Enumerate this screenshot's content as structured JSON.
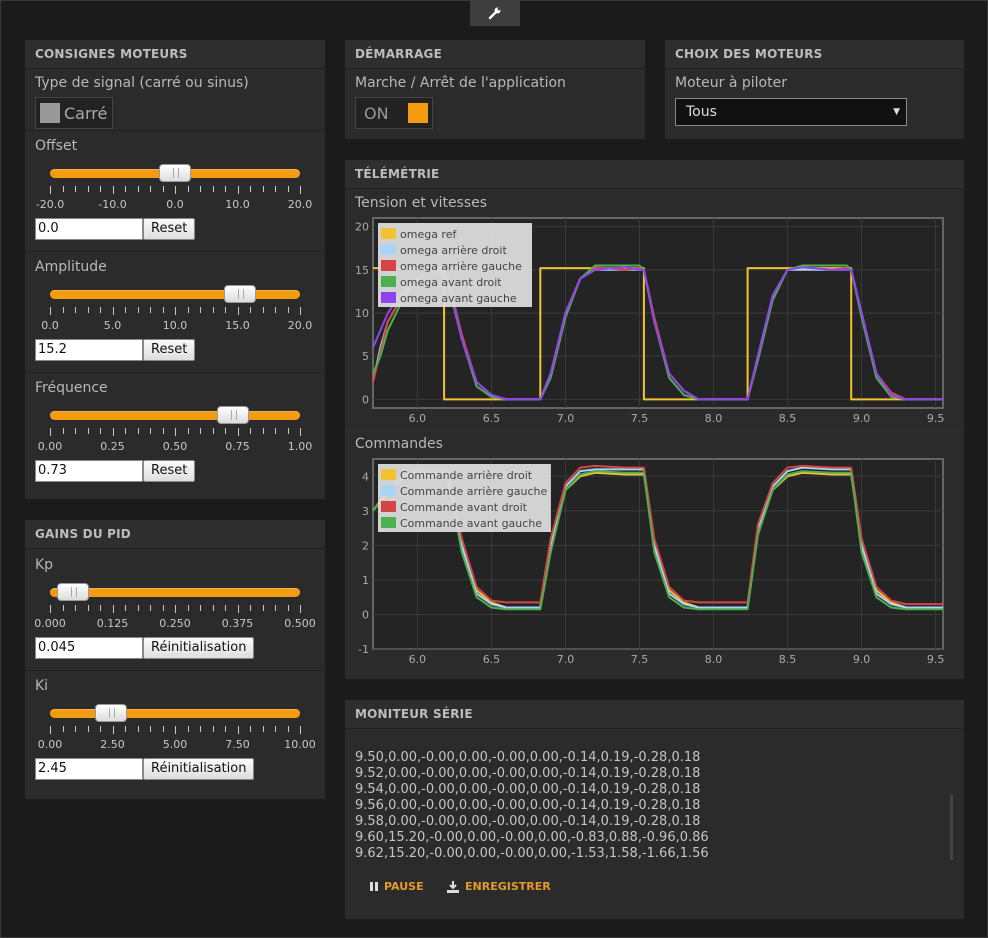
{
  "toolbar": {
    "settings_icon": "wrench-icon"
  },
  "consignes": {
    "title": "CONSIGNES MOTEURS",
    "signal_label": "Type de signal (carré ou sinus)",
    "signal_value": "Carré",
    "sliders": [
      {
        "label": "Offset",
        "value": "0.0",
        "reset": "Reset",
        "min": -20,
        "max": 20,
        "current": 0,
        "ticks": [
          "-20.0",
          "-10.0",
          "0.0",
          "10.0",
          "20.0"
        ]
      },
      {
        "label": "Amplitude",
        "value": "15.2",
        "reset": "Reset",
        "min": 0,
        "max": 20,
        "current": 15.2,
        "ticks": [
          "0.0",
          "5.0",
          "10.0",
          "15.0",
          "20.0"
        ]
      },
      {
        "label": "Fréquence",
        "value": "0.73",
        "reset": "Reset",
        "min": 0,
        "max": 1,
        "current": 0.73,
        "ticks": [
          "0.00",
          "0.25",
          "0.50",
          "0.75",
          "1.00"
        ]
      }
    ]
  },
  "pid": {
    "title": "GAINS DU PID",
    "sliders": [
      {
        "label": "Kp",
        "value": "0.045",
        "reset": "Réinitialisation",
        "min": 0,
        "max": 0.5,
        "current": 0.045,
        "ticks": [
          "0.000",
          "0.125",
          "0.250",
          "0.375",
          "0.500"
        ]
      },
      {
        "label": "Ki",
        "value": "2.45",
        "reset": "Réinitialisation",
        "min": 0,
        "max": 10,
        "current": 2.45,
        "ticks": [
          "0.00",
          "2.50",
          "5.00",
          "7.50",
          "10.00"
        ]
      }
    ]
  },
  "demarrage": {
    "title": "DÉMARRAGE",
    "label": "Marche / Arrêt de l'application",
    "toggle": "ON",
    "toggle_color": "#f39c12"
  },
  "choix": {
    "title": "CHOIX DES MOTEURS",
    "label": "Moteur à piloter",
    "selected": "Tous"
  },
  "telemetrie": {
    "title": "TÉLÉMÉTRIE",
    "chart1_title": "Tension et vitesses",
    "chart2_title": "Commandes"
  },
  "chart_data": [
    {
      "type": "line",
      "title": "Tension et vitesses",
      "xlim": [
        5.7,
        9.55
      ],
      "ylim": [
        -1,
        21
      ],
      "xticks": [
        "6.0",
        "6.5",
        "7.0",
        "7.5",
        "8.0",
        "8.5",
        "9.0",
        "9.5"
      ],
      "yticks": [
        "0",
        "5",
        "10",
        "15",
        "20"
      ],
      "legend_position": "top-left",
      "series": [
        {
          "name": "omega ref",
          "color": "#f1c232",
          "step": true,
          "x": [
            5.7,
            6.18,
            6.18,
            6.83,
            6.83,
            7.53,
            7.53,
            8.23,
            8.23,
            8.93,
            8.93,
            9.55
          ],
          "y": [
            15.2,
            15.2,
            0,
            0,
            15.2,
            15.2,
            0,
            0,
            15.2,
            15.2,
            0,
            0
          ]
        },
        {
          "name": "omega arrière droit",
          "color": "#a8d4f5",
          "x": [
            5.7,
            5.75,
            5.8,
            5.9,
            6.0,
            6.1,
            6.2,
            6.3,
            6.4,
            6.5,
            6.6,
            6.8,
            6.83,
            6.9,
            7.0,
            7.1,
            7.2,
            7.4,
            7.5,
            7.53,
            7.6,
            7.7,
            7.8,
            7.9,
            8.2,
            8.23,
            8.3,
            8.4,
            8.5,
            8.6,
            8.8,
            8.9,
            8.93,
            9.0,
            9.1,
            9.2,
            9.3,
            9.55
          ],
          "y": [
            2,
            6,
            9,
            12,
            14,
            15,
            14,
            7,
            2,
            0.5,
            0,
            0,
            0,
            3,
            10,
            14,
            15,
            15,
            15,
            15,
            9,
            3,
            1,
            0,
            0,
            0,
            5,
            12,
            15,
            15,
            15,
            15,
            15,
            10,
            3,
            0.5,
            0,
            0
          ]
        },
        {
          "name": "omega arrière gauche",
          "color": "#d64545",
          "x": [
            5.7,
            5.75,
            5.8,
            5.9,
            6.0,
            6.1,
            6.2,
            6.3,
            6.4,
            6.5,
            6.6,
            6.8,
            6.83,
            6.9,
            7.0,
            7.1,
            7.2,
            7.4,
            7.5,
            7.53,
            7.6,
            7.7,
            7.8,
            7.9,
            8.2,
            8.23,
            8.3,
            8.4,
            8.5,
            8.6,
            8.8,
            8.9,
            8.93,
            9.0,
            9.1,
            9.2,
            9.3,
            9.55
          ],
          "y": [
            2,
            5.5,
            9,
            12,
            14,
            15,
            14.5,
            7.5,
            2,
            0.5,
            0,
            0,
            0,
            3,
            10,
            14,
            15.3,
            15,
            15.2,
            15,
            9.5,
            3,
            1,
            0,
            0,
            0,
            5,
            12,
            15,
            15.3,
            15,
            15.2,
            15,
            10,
            3,
            0.8,
            0,
            0
          ]
        },
        {
          "name": "omega avant droit",
          "color": "#4caf50",
          "x": [
            5.7,
            5.75,
            5.8,
            5.9,
            6.0,
            6.1,
            6.2,
            6.3,
            6.4,
            6.5,
            6.6,
            6.8,
            6.83,
            6.9,
            7.0,
            7.1,
            7.2,
            7.4,
            7.5,
            7.53,
            7.6,
            7.7,
            7.8,
            7.9,
            8.2,
            8.23,
            8.3,
            8.4,
            8.5,
            8.6,
            8.8,
            8.9,
            8.93,
            9.0,
            9.1,
            9.2,
            9.3,
            9.55
          ],
          "y": [
            3,
            5,
            8,
            11.5,
            14,
            15,
            14,
            7,
            1.5,
            0.3,
            0,
            0,
            0,
            2.5,
            9.5,
            14,
            15.5,
            15.5,
            15.5,
            15,
            9,
            2.5,
            0.5,
            0,
            0,
            0,
            4.5,
            11.5,
            15,
            15.5,
            15.5,
            15.5,
            15,
            9.5,
            2.5,
            0.3,
            0,
            0
          ]
        },
        {
          "name": "omega avant gauche",
          "color": "#8e44ec",
          "x": [
            5.7,
            5.75,
            5.8,
            5.9,
            6.0,
            6.1,
            6.2,
            6.3,
            6.4,
            6.5,
            6.6,
            6.8,
            6.83,
            6.9,
            7.0,
            7.1,
            7.2,
            7.4,
            7.5,
            7.53,
            7.6,
            7.7,
            7.8,
            7.9,
            8.2,
            8.23,
            8.3,
            8.4,
            8.5,
            8.6,
            8.8,
            8.9,
            8.93,
            9.0,
            9.1,
            9.2,
            9.3,
            9.55
          ],
          "y": [
            6,
            8,
            10,
            12.5,
            14,
            15,
            14.5,
            7,
            2,
            0.5,
            0,
            0,
            0,
            3,
            10,
            14,
            15,
            15.3,
            15,
            15,
            9,
            3,
            1,
            0,
            0,
            0,
            5,
            12,
            15,
            15.3,
            15,
            15,
            15,
            10,
            3,
            0.5,
            0,
            0
          ]
        }
      ]
    },
    {
      "type": "line",
      "title": "Commandes",
      "xlim": [
        5.7,
        9.55
      ],
      "ylim": [
        -1,
        4.5
      ],
      "xticks": [
        "6.0",
        "6.5",
        "7.0",
        "7.5",
        "8.0",
        "8.5",
        "9.0",
        "9.5"
      ],
      "yticks": [
        "-1",
        "0",
        "1",
        "2",
        "3",
        "4"
      ],
      "legend_position": "top-left",
      "series": [
        {
          "name": "Commande arrière droit",
          "color": "#f1c232",
          "x": [
            5.7,
            5.8,
            5.9,
            6.0,
            6.1,
            6.2,
            6.3,
            6.4,
            6.5,
            6.6,
            6.8,
            6.83,
            6.9,
            7.0,
            7.1,
            7.2,
            7.4,
            7.53,
            7.6,
            7.7,
            7.8,
            7.9,
            8.1,
            8.23,
            8.3,
            8.4,
            8.5,
            8.6,
            8.8,
            8.93,
            9.0,
            9.1,
            9.2,
            9.3,
            9.55
          ],
          "y": [
            3,
            3.6,
            4,
            4.05,
            4.05,
            4.05,
            2,
            0.7,
            0.35,
            0.2,
            0.2,
            0.2,
            2,
            3.6,
            4,
            4.1,
            4.05,
            4.05,
            2,
            0.7,
            0.35,
            0.2,
            0.2,
            0.2,
            2.5,
            3.6,
            4,
            4.1,
            4.05,
            4.05,
            2,
            0.7,
            0.35,
            0.2,
            0.2
          ]
        },
        {
          "name": "Commande arrière gauche",
          "color": "#a8d4f5",
          "x": [
            5.7,
            5.8,
            5.9,
            6.0,
            6.1,
            6.2,
            6.3,
            6.4,
            6.5,
            6.6,
            6.8,
            6.83,
            6.9,
            7.0,
            7.1,
            7.2,
            7.4,
            7.53,
            7.6,
            7.7,
            7.8,
            7.9,
            8.1,
            8.23,
            8.3,
            8.4,
            8.5,
            8.6,
            8.8,
            8.93,
            9.0,
            9.1,
            9.2,
            9.3,
            9.55
          ],
          "y": [
            3,
            3.6,
            4,
            4.1,
            4.1,
            4.1,
            2,
            0.6,
            0.3,
            0.2,
            0.2,
            0.2,
            2,
            3.7,
            4.15,
            4.2,
            4.2,
            4.2,
            2,
            0.6,
            0.3,
            0.2,
            0.2,
            0.2,
            2.5,
            3.7,
            4.15,
            4.25,
            4.2,
            4.2,
            2,
            0.6,
            0.3,
            0.2,
            0.2
          ]
        },
        {
          "name": "Commande avant droit",
          "color": "#d64545",
          "x": [
            5.7,
            5.8,
            5.9,
            6.0,
            6.1,
            6.2,
            6.3,
            6.4,
            6.5,
            6.6,
            6.8,
            6.83,
            6.9,
            7.0,
            7.1,
            7.2,
            7.4,
            7.53,
            7.6,
            7.7,
            7.8,
            7.9,
            8.1,
            8.23,
            8.3,
            8.4,
            8.5,
            8.6,
            8.8,
            8.93,
            9.0,
            9.1,
            9.2,
            9.3,
            9.55
          ],
          "y": [
            3,
            3.6,
            4,
            4.2,
            4.2,
            4.2,
            2.2,
            0.8,
            0.4,
            0.35,
            0.35,
            0.35,
            2.2,
            3.8,
            4.25,
            4.3,
            4.25,
            4.25,
            2.2,
            0.8,
            0.4,
            0.35,
            0.35,
            0.35,
            2.6,
            3.8,
            4.25,
            4.3,
            4.25,
            4.25,
            2.2,
            0.8,
            0.4,
            0.3,
            0.3
          ]
        },
        {
          "name": "Commande avant gauche",
          "color": "#4caf50",
          "x": [
            5.7,
            5.8,
            5.9,
            6.0,
            6.1,
            6.2,
            6.3,
            6.4,
            6.5,
            6.6,
            6.8,
            6.83,
            6.9,
            7.0,
            7.1,
            7.2,
            7.4,
            7.53,
            7.6,
            7.7,
            7.8,
            7.9,
            8.1,
            8.23,
            8.3,
            8.4,
            8.5,
            8.6,
            8.8,
            8.93,
            9.0,
            9.1,
            9.2,
            9.3,
            9.55
          ],
          "y": [
            3,
            3.5,
            3.95,
            4.1,
            4.1,
            4.1,
            1.8,
            0.5,
            0.2,
            0.15,
            0.15,
            0.15,
            1.8,
            3.6,
            4.05,
            4.15,
            4.1,
            4.1,
            1.8,
            0.5,
            0.2,
            0.15,
            0.15,
            0.15,
            2.3,
            3.6,
            4.05,
            4.15,
            4.1,
            4.1,
            1.8,
            0.5,
            0.2,
            0.15,
            0.15
          ]
        }
      ]
    }
  ],
  "moniteur": {
    "title": "MONITEUR SÉRIE",
    "lines": [
      "9.50,0.00,-0.00,0.00,-0.00,0.00,-0.14,0.19,-0.28,0.18",
      "9.52,0.00,-0.00,0.00,-0.00,0.00,-0.14,0.19,-0.28,0.18",
      "9.54,0.00,-0.00,0.00,-0.00,0.00,-0.14,0.19,-0.28,0.18",
      "9.56,0.00,-0.00,0.00,-0.00,0.00,-0.14,0.19,-0.28,0.18",
      "9.58,0.00,-0.00,0.00,-0.00,0.00,-0.14,0.19,-0.28,0.18",
      "9.60,15.20,-0.00,0.00,-0.00,0.00,-0.83,0.88,-0.96,0.86",
      "9.62,15.20,-0.00,0.00,-0.00,0.00,-1.53,1.58,-1.66,1.56"
    ],
    "pause": "PAUSE",
    "save": "ENREGISTRER"
  }
}
